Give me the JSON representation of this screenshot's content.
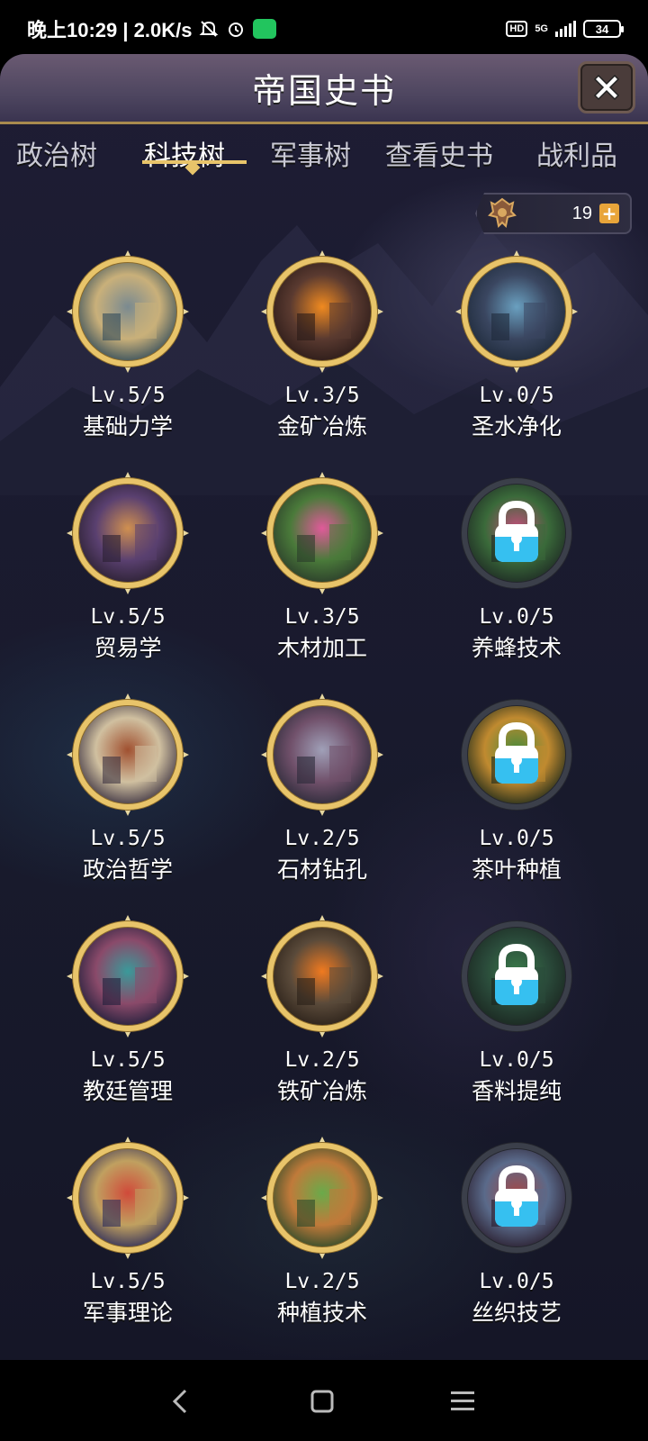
{
  "status_bar": {
    "time": "晚上10:29 | 2.0K/s",
    "hd": "HD",
    "network": "5G",
    "battery": "34"
  },
  "header": {
    "title": "帝国史书"
  },
  "tabs": [
    {
      "label": "政治树",
      "active": false
    },
    {
      "label": "科技树",
      "active": true
    },
    {
      "label": "军事树",
      "active": false
    },
    {
      "label": "查看史书",
      "active": false
    },
    {
      "label": "战利品",
      "active": false
    }
  ],
  "currency": {
    "icon": "crest-icon",
    "count": "19",
    "plus": "+"
  },
  "techs": [
    {
      "level": "Lv.5/5",
      "name": "基础力学",
      "locked": false,
      "art": "statue"
    },
    {
      "level": "Lv.3/5",
      "name": "金矿冶炼",
      "locked": false,
      "art": "forge"
    },
    {
      "level": "Lv.0/5",
      "name": "圣水净化",
      "locked": false,
      "art": "shrine"
    },
    {
      "level": "Lv.5/5",
      "name": "贸易学",
      "locked": false,
      "art": "market"
    },
    {
      "level": "Lv.3/5",
      "name": "木材加工",
      "locked": false,
      "art": "tree"
    },
    {
      "level": "Lv.0/5",
      "name": "养蜂技术",
      "locked": true,
      "art": "forest"
    },
    {
      "level": "Lv.5/5",
      "name": "政治哲学",
      "locked": false,
      "art": "sage"
    },
    {
      "level": "Lv.2/5",
      "name": "石材钻孔",
      "locked": false,
      "art": "drill"
    },
    {
      "level": "Lv.0/5",
      "name": "茶叶种植",
      "locked": true,
      "art": "field"
    },
    {
      "level": "Lv.5/5",
      "name": "教廷管理",
      "locked": false,
      "art": "church"
    },
    {
      "level": "Lv.2/5",
      "name": "铁矿冶炼",
      "locked": false,
      "art": "furnace"
    },
    {
      "level": "Lv.0/5",
      "name": "香料提纯",
      "locked": true,
      "art": "jungle"
    },
    {
      "level": "Lv.5/5",
      "name": "军事理论",
      "locked": false,
      "art": "knight"
    },
    {
      "level": "Lv.2/5",
      "name": "种植技术",
      "locked": false,
      "art": "farm"
    },
    {
      "level": "Lv.0/5",
      "name": "丝织技艺",
      "locked": true,
      "art": "town"
    }
  ],
  "colors": {
    "gold": "#e8c46a",
    "lock_blue": "#36c0f0",
    "locked_ring": "#3b3f4a"
  }
}
